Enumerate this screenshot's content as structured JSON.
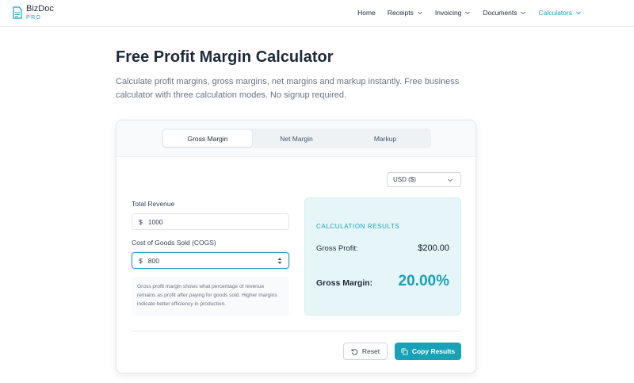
{
  "brand": {
    "name": "BizDoc",
    "sub": "PRO",
    "icon": "document-icon",
    "accent": "#17a2b8"
  },
  "nav": [
    {
      "label": "Home",
      "dropdown": false,
      "active": false
    },
    {
      "label": "Receipts",
      "dropdown": true,
      "active": false
    },
    {
      "label": "Invoicing",
      "dropdown": true,
      "active": false
    },
    {
      "label": "Documents",
      "dropdown": true,
      "active": false
    },
    {
      "label": "Calculators",
      "dropdown": true,
      "active": true
    }
  ],
  "page": {
    "title": "Free Profit Margin Calculator",
    "description": "Calculate profit margins, gross margins, net margins and markup instantly. Free business calculator with three calculation modes. No signup required."
  },
  "tabs": [
    {
      "label": "Gross Margin",
      "active": true
    },
    {
      "label": "Net Margin",
      "active": false
    },
    {
      "label": "Markup",
      "active": false
    }
  ],
  "currency": {
    "selected": "USD ($)"
  },
  "form": {
    "revenue": {
      "label": "Total Revenue",
      "symbol": "$",
      "value": "1000"
    },
    "cogs": {
      "label": "Cost of Goods Sold (COGS)",
      "symbol": "$",
      "value": "800"
    },
    "note": "Gross profit margin shows what percentage of revenue remains as profit after paying for goods sold. Higher margins indicate better efficiency in production."
  },
  "results": {
    "heading": "CALCULATION RESULTS",
    "gross_profit_label": "Gross Profit:",
    "gross_profit_value": "$200.00",
    "gross_margin_label": "Gross Margin:",
    "gross_margin_value": "20.00%"
  },
  "actions": {
    "reset": "Reset",
    "copy": "Copy Results"
  }
}
